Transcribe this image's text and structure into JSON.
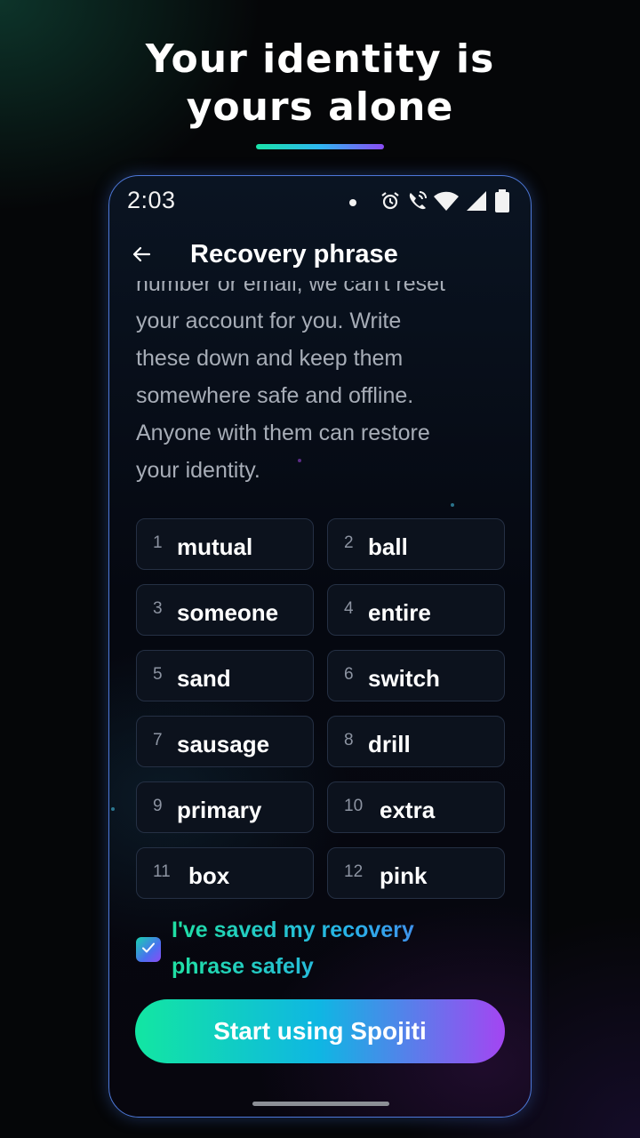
{
  "headline": {
    "lines": [
      "Your identity is",
      "yours alone"
    ],
    "accent_gradient": [
      "#19e3a8",
      "#2fb6f0",
      "#8b4cf5"
    ]
  },
  "status_bar": {
    "time": "2:03",
    "icons": [
      "notification-dot-icon",
      "alarm-icon",
      "wifi-call-icon",
      "wifi-icon",
      "signal-icon",
      "battery-icon"
    ]
  },
  "app_bar": {
    "back_icon": "arrow-left-icon",
    "title": "Recovery phrase"
  },
  "description": {
    "lines": [
      "number or email, we can't reset",
      "your account for you. Write",
      "these down and keep them",
      "somewhere safe and offline.",
      "Anyone with them can restore",
      "your identity."
    ]
  },
  "words": [
    {
      "num": "1",
      "word": "mutual"
    },
    {
      "num": "2",
      "word": "ball"
    },
    {
      "num": "3",
      "word": "someone"
    },
    {
      "num": "4",
      "word": "entire"
    },
    {
      "num": "5",
      "word": "sand"
    },
    {
      "num": "6",
      "word": "switch"
    },
    {
      "num": "7",
      "word": "sausage"
    },
    {
      "num": "8",
      "word": "drill"
    },
    {
      "num": "9",
      "word": "primary"
    },
    {
      "num": "10",
      "word": "extra"
    },
    {
      "num": "11",
      "word": "box"
    },
    {
      "num": "12",
      "word": "pink"
    }
  ],
  "confirm": {
    "checked": true,
    "label": "I've saved my recovery phrase safely"
  },
  "cta": {
    "label": "Start using Spojiti"
  },
  "colors": {
    "accent_green": "#12e6a2",
    "accent_blue": "#0fb6e3",
    "accent_purple": "#a445f2",
    "frame_border": "#4d78d8"
  }
}
